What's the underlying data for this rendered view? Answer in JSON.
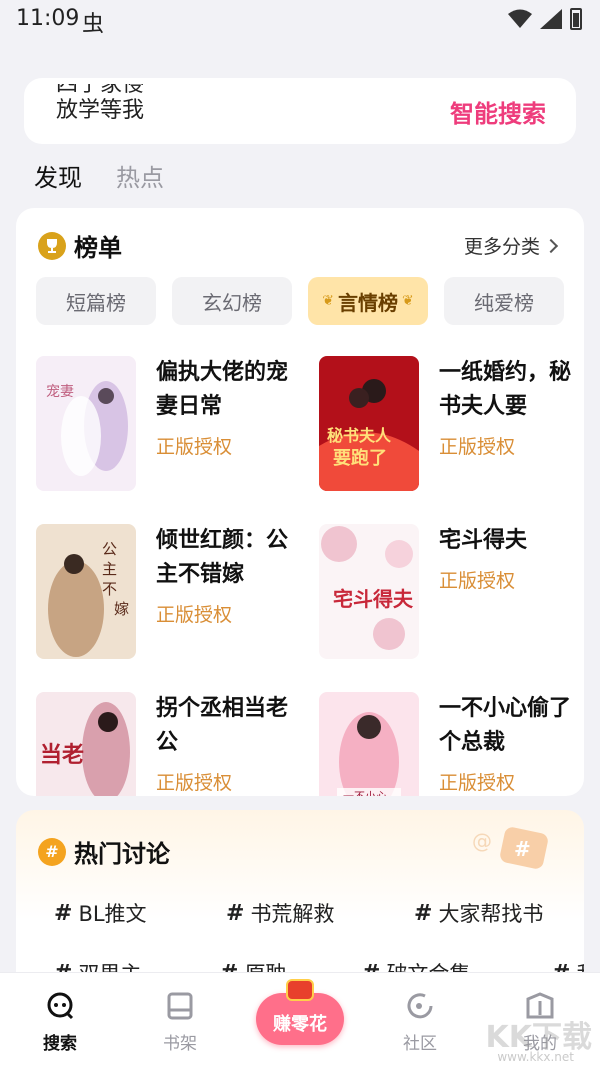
{
  "status": {
    "time": "11:09",
    "app_glyph": "虫"
  },
  "search": {
    "hints": [
      "四子家侵",
      "放学等我"
    ],
    "button": "智能搜索"
  },
  "tabs": [
    {
      "label": "发现"
    },
    {
      "label": "热点"
    }
  ],
  "ranking": {
    "title": "榜单",
    "more": "更多分类",
    "chips": [
      "短篇榜",
      "玄幻榜",
      "言情榜",
      "纯爱榜"
    ],
    "active_chip": 2,
    "books": [
      {
        "title": "偏执大佬的宠妻日常",
        "tag": "正版授权",
        "cover_colors": [
          "#f6eef7",
          "#d8c4e5"
        ]
      },
      {
        "title": "一纸婚约，秘书夫人要",
        "tag": "正版授权",
        "cover_colors": [
          "#b3101a",
          "#f04a3a"
        ],
        "cover_text": "秘书夫人要跑了"
      },
      {
        "title": "倾世红颜：公主不错嫁",
        "tag": "正版授权",
        "cover_colors": [
          "#efe1d0",
          "#b78a63"
        ],
        "cover_text": "公主不错嫁"
      },
      {
        "title": "宅斗得夫",
        "tag": "正版授权",
        "cover_colors": [
          "#fbf4f6",
          "#f0c4d0"
        ],
        "cover_text": "宅斗得夫"
      },
      {
        "title": "拐个丞相当老公",
        "tag": "正版授权",
        "cover_colors": [
          "#f7e8ec",
          "#d9a0ad"
        ],
        "cover_text": "当老"
      },
      {
        "title": "一不小心偷了个总裁",
        "tag": "正版授权",
        "cover_colors": [
          "#fce4ec",
          "#f5b0c3"
        ],
        "cover_text": "一不小心"
      }
    ]
  },
  "discussion": {
    "title": "热门讨论",
    "topics": [
      "BL推文",
      "书荒解救",
      "大家帮找书",
      "双男主",
      "原耽",
      "破文合集",
      "我"
    ]
  },
  "nav": [
    {
      "label": "搜索",
      "icon": "search-face-icon"
    },
    {
      "label": "书架",
      "icon": "book-icon"
    },
    {
      "label": "赚零花",
      "icon": "red-pouch-icon"
    },
    {
      "label": "社区",
      "icon": "community-icon"
    },
    {
      "label": "我的",
      "icon": "profile-icon"
    }
  ],
  "watermark": {
    "text": "KK下载",
    "sub": "www.kkx.net"
  }
}
